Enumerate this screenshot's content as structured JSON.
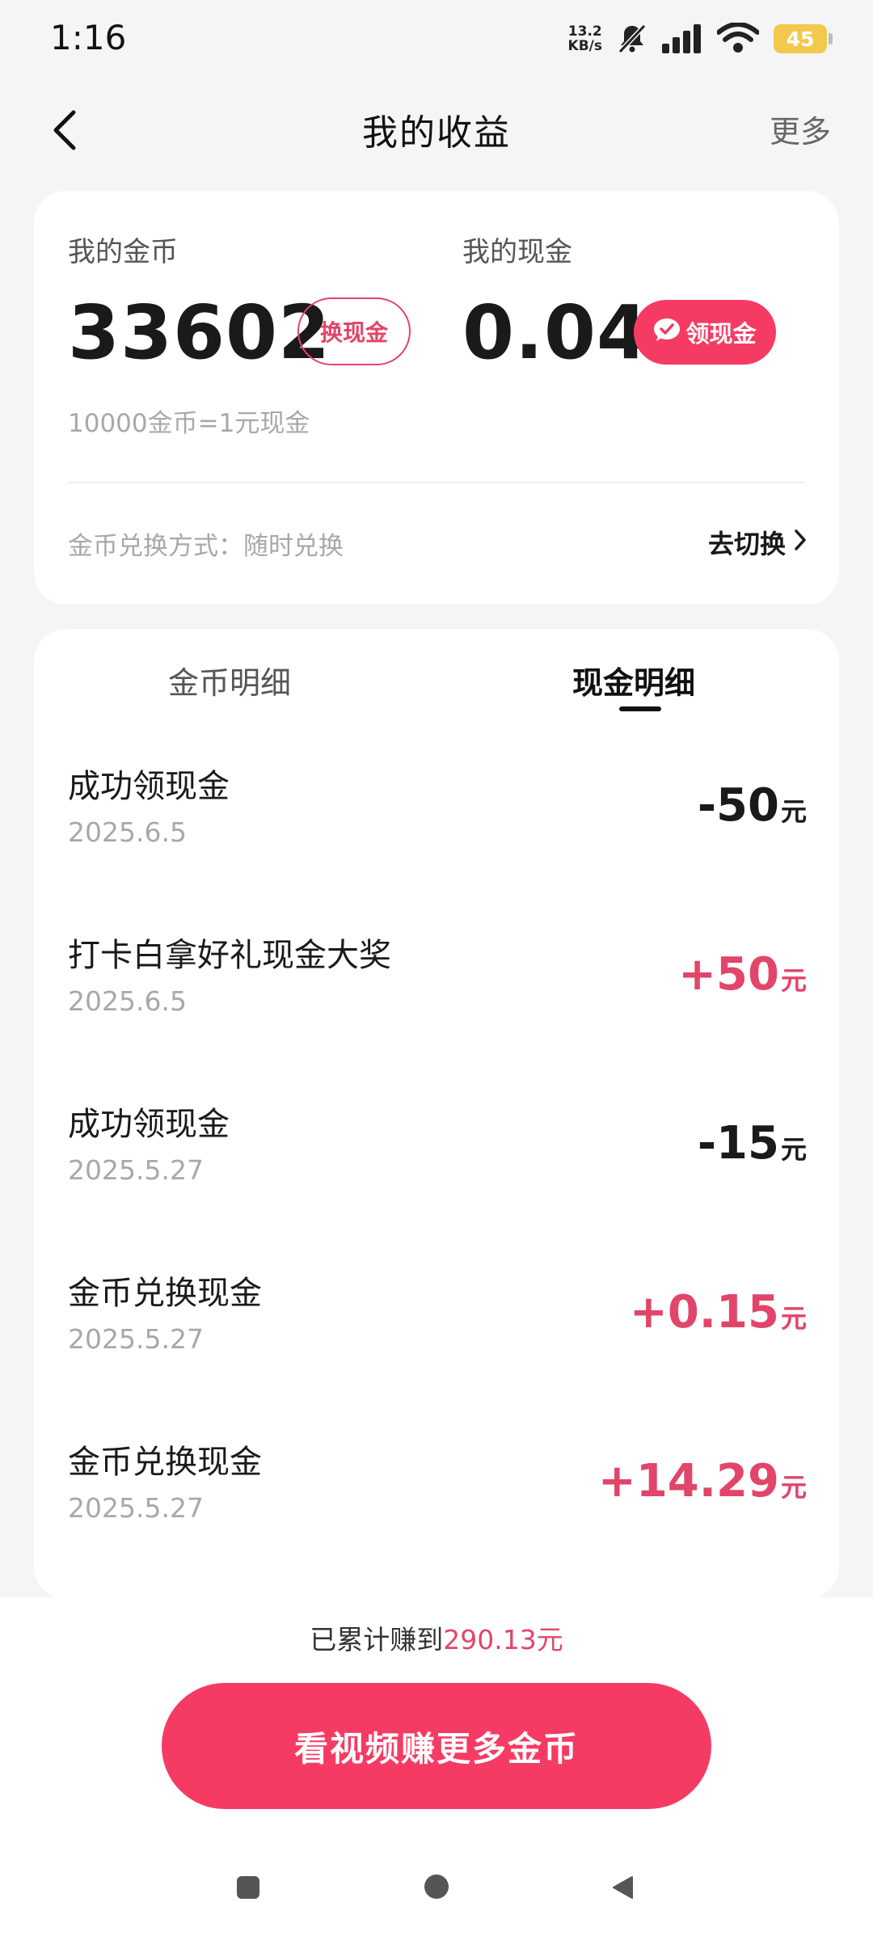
{
  "status": {
    "time": "1:16",
    "net_speed_value": "13.2",
    "net_speed_unit": "KB/s",
    "battery": "45"
  },
  "nav": {
    "title": "我的收益",
    "more": "更多"
  },
  "balance": {
    "coin_label": "我的金币",
    "coin_value": "33602",
    "coin_button": "换现金",
    "cash_label": "我的现金",
    "cash_value": "0.04",
    "cash_button": "领现金",
    "rate": "10000金币=1元现金",
    "method": "金币兑换方式：随时兑换",
    "switch": "去切换"
  },
  "tabs": {
    "coin_detail": "金币明细",
    "cash_detail": "现金明细",
    "active": "cash_detail"
  },
  "records": [
    {
      "title": "成功领现金",
      "date": "2025.6.5",
      "amount": "-50",
      "unit": "元"
    },
    {
      "title": "打卡白拿好礼现金大奖",
      "date": "2025.6.5",
      "amount": "+50",
      "unit": "元"
    },
    {
      "title": "成功领现金",
      "date": "2025.5.27",
      "amount": "-15",
      "unit": "元"
    },
    {
      "title": "金币兑换现金",
      "date": "2025.5.27",
      "amount": "+0.15",
      "unit": "元"
    },
    {
      "title": "金币兑换现金",
      "date": "2025.5.27",
      "amount": "+14.29",
      "unit": "元"
    }
  ],
  "footer": {
    "total_prefix": "已累计赚到",
    "total_value": "290.13元",
    "cta": "看视频赚更多金币"
  },
  "colors": {
    "accent": "#f53b64",
    "positive_text": "#e2456a",
    "background": "#f5f5f7"
  }
}
